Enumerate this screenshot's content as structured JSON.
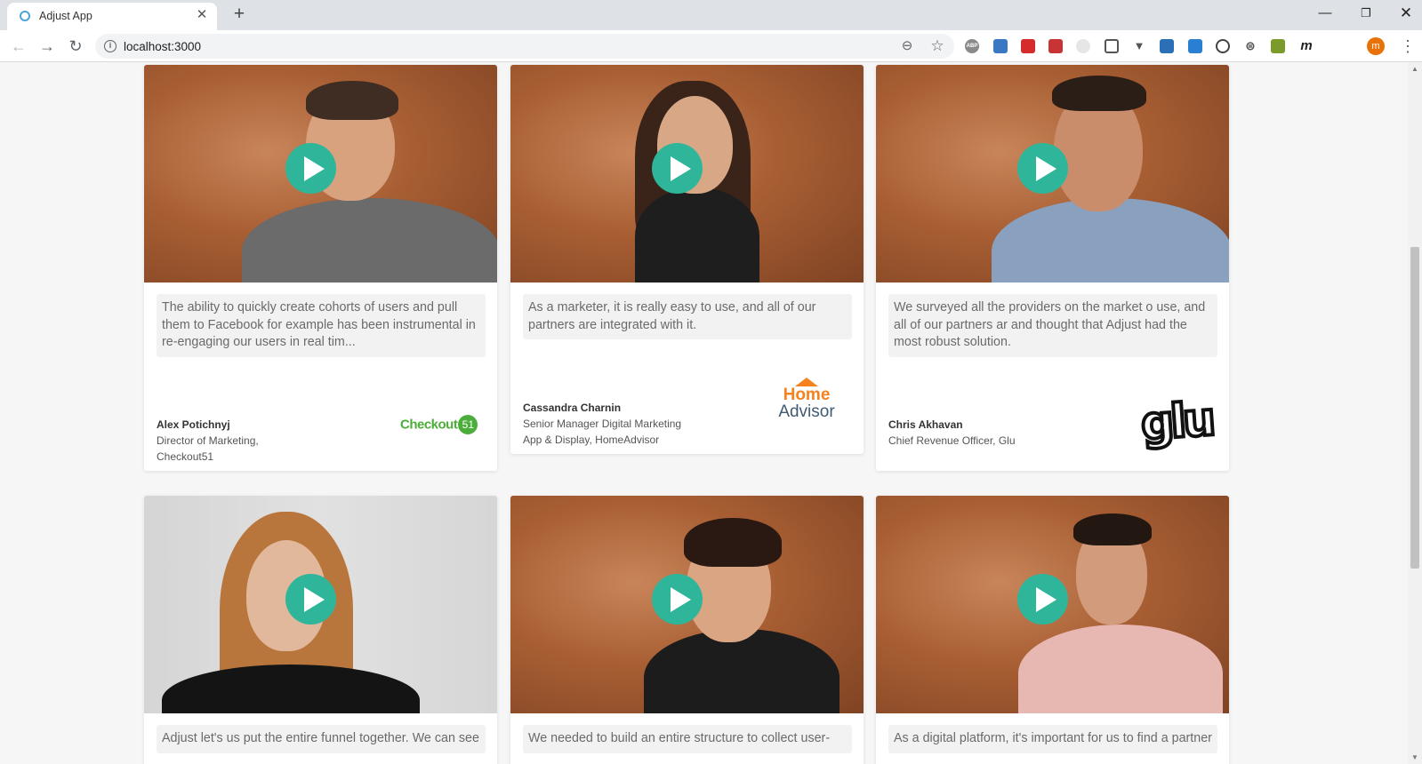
{
  "browser": {
    "tab_title": "Adjust App",
    "tab_close": "✕",
    "new_tab": "+",
    "url": "localhost:3000",
    "window_buttons": {
      "minimize": "—",
      "maximize": "❐",
      "close": "✕"
    },
    "profile_initial": "m",
    "extensions": [
      "ABP",
      "",
      "",
      "",
      "",
      "",
      "",
      "",
      "",
      "",
      "",
      "",
      "m"
    ]
  },
  "testimonials": [
    {
      "quote": "The ability to quickly create cohorts of users and pull them to Facebook for example has been instrumental in re-engaging our users in real tim...",
      "name": "Alex Potichnyj",
      "role": "Director of Marketing, Checkout51",
      "logo": {
        "word": "Checkout",
        "badge": "51"
      }
    },
    {
      "quote": "As a marketer, it is really easy to use, and all of our partners are integrated with it.",
      "name": "Cassandra Charnin",
      "role": "Senior Manager Digital Marketing App & Display, HomeAdvisor",
      "logo": {
        "line1": "Home",
        "line2": "Advisor"
      }
    },
    {
      "quote": "We surveyed all the providers on the market o use, and all of our partners ar and thought that Adjust had the most robust solution.",
      "name": "Chris Akhavan",
      "role": "Chief Revenue Officer, Glu",
      "logo": {
        "word": "glu"
      }
    },
    {
      "quote": "Adjust let's us put the entire funnel together. We can see"
    },
    {
      "quote": "We needed to build an entire structure to collect user-"
    },
    {
      "quote": "As a digital platform, it's important for us to find a partner"
    }
  ],
  "colors": {
    "play_button": "#2fb59a",
    "checkout_green": "#4cae3a",
    "homeadvisor_orange": "#f5821f",
    "homeadvisor_blue": "#3f5a72"
  }
}
